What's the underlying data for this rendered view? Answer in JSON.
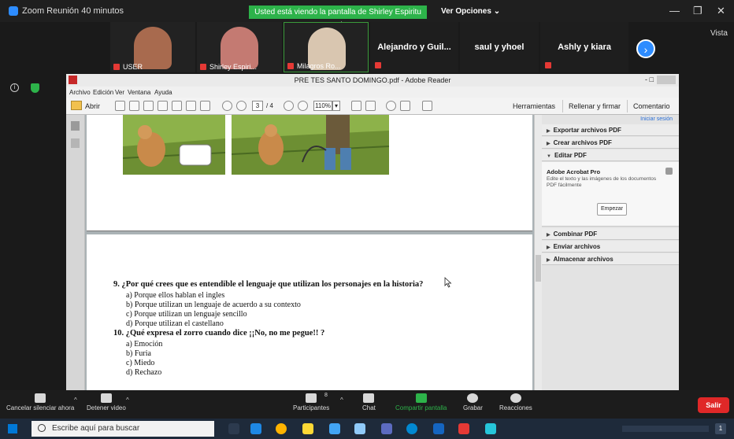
{
  "zoom": {
    "window_title": "Zoom Reunión 40 minutos",
    "share_banner": "Usted está viendo la pantalla de Shirley Espiritu Ortiz",
    "view_options": "Ver Opciones ⌄",
    "vista_label": "Vista",
    "next_icon": "chevron-right-icon"
  },
  "participants": [
    {
      "name": "USER",
      "kind": "video",
      "color": "#a86a4e"
    },
    {
      "name": "Shirley Espiri...",
      "kind": "video",
      "color": "#c47a72"
    },
    {
      "name": "Milagros Ro...",
      "kind": "video",
      "color": "#d9c6b0"
    },
    {
      "name": "Alejandro  y  Guil...",
      "kind": "name"
    },
    {
      "name": "saul y yhoel",
      "kind": "name"
    },
    {
      "name": "Ashly y kiara",
      "kind": "name"
    }
  ],
  "reader": {
    "title": "PRE TES SANTO DOMINGO.pdf - Adobe Reader",
    "menu": [
      "Archivo",
      "Edición",
      "Ver",
      "Ventana",
      "Ayuda"
    ],
    "open_label": "Abrir",
    "page_current": "3",
    "page_total": "/ 4",
    "zoom_level": "110%",
    "tools_label": "Herramientas",
    "fill_sign_label": "Rellenar y firmar",
    "comment_label": "Comentario"
  },
  "panel": {
    "login": "Iniciar sesión",
    "items_top": [
      "Exportar archivos PDF",
      "Crear archivos PDF",
      "Editar PDF"
    ],
    "acrobat_title": "Adobe Acrobat Pro",
    "acrobat_desc": "Edite el texto y las imágenes de los documentos PDF fácilmente",
    "start_button": "Empezar",
    "items_bottom": [
      "Combinar PDF",
      "Enviar archivos",
      "Almacenar archivos"
    ]
  },
  "document": {
    "q9": "9.   ¿Por qué crees que es entendible el lenguaje que utilizan los personajes en la historia?",
    "q9_options": [
      "a)  Porque ellos hablan el ingles",
      "b)  Porque utilizan un lenguaje de acuerdo a su contexto",
      "c)  Porque utilizan un lenguaje sencillo",
      "d)  Porque utilizan el castellano"
    ],
    "q10": "10. ¿Qué expresa el zorro cuando dice ¡¡No, no me pegue!! ?",
    "q10_options": [
      "a)  Emoción",
      "b)  Furia",
      "c)  Miedo",
      "d)  Rechazo"
    ]
  },
  "controls": {
    "mute": "Cancelar silenciar ahora",
    "video": "Detener video",
    "participants": "Participantes",
    "participant_count": "8",
    "chat": "Chat",
    "share": "Compartir pantalla",
    "record": "Grabar",
    "reactions": "Reacciones",
    "leave": "Salir"
  },
  "taskbar": {
    "search_placeholder": "Escribe aquí para buscar",
    "notification_count": "1",
    "app_colors": [
      "#1e88e5",
      "#ffb300",
      "#fdd835",
      "#42a5f5",
      "#90caf9",
      "#5c6bc0",
      "#0288d1",
      "#e53935",
      "#26c6da",
      "#1565c0"
    ]
  }
}
